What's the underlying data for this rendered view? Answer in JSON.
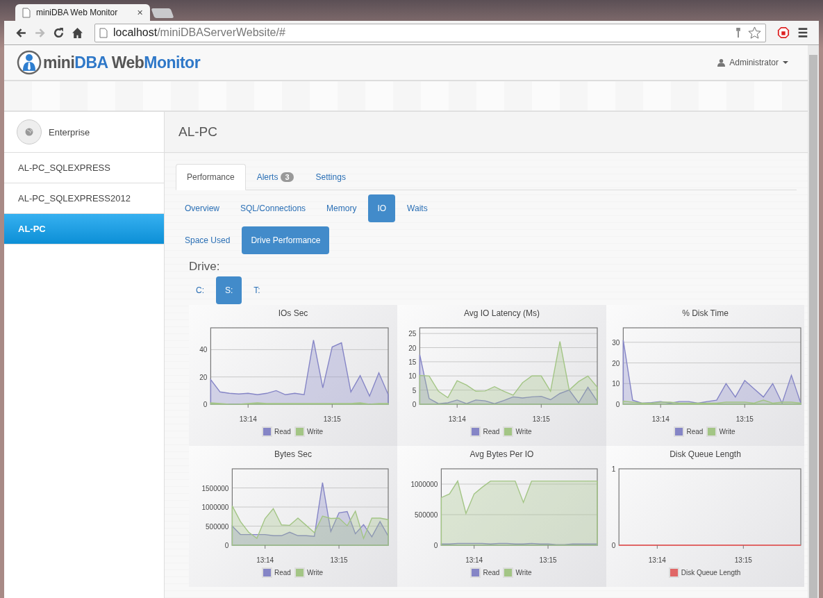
{
  "browser": {
    "tab_title": "miniDBA Web Monitor",
    "tab_close": "✕",
    "address": [
      {
        "text": "localhost",
        "dim": false
      },
      {
        "text": "/miniDBAServerWebsite/#",
        "dim": true
      }
    ]
  },
  "app": {
    "logo": [
      {
        "text": "mini",
        "accent": false
      },
      {
        "text": "DBA",
        "accent": true
      },
      {
        "text": " Web",
        "accent": false
      },
      {
        "text": "Monitor",
        "accent": true
      }
    ],
    "user": "Administrator"
  },
  "sidebar": {
    "items": [
      {
        "label": "Enterprise",
        "kind": "group",
        "selected": false
      },
      {
        "label": "AL-PC_SQLEXPRESS",
        "kind": "server",
        "selected": false
      },
      {
        "label": "AL-PC_SQLEXPRESS2012",
        "kind": "server",
        "selected": false
      },
      {
        "label": "AL-PC",
        "kind": "server",
        "selected": true
      }
    ]
  },
  "page_title": "AL-PC",
  "tabs": [
    {
      "label": "Performance",
      "selected": true
    },
    {
      "label": "Alerts",
      "badge": "3",
      "selected": false
    },
    {
      "label": "Settings",
      "selected": false
    }
  ],
  "subtabs": [
    {
      "label": "Overview",
      "selected": false
    },
    {
      "label": "SQL/Connections",
      "selected": false
    },
    {
      "label": "Memory",
      "selected": false
    },
    {
      "label": "IO",
      "selected": true
    },
    {
      "label": "Waits",
      "selected": false
    }
  ],
  "subtabs_2": [
    {
      "label": "Space Used",
      "selected": false
    },
    {
      "label": "Drive Performance",
      "selected": true
    }
  ],
  "drive": {
    "label": "Drive:",
    "options": [
      {
        "label": "C:",
        "selected": false
      },
      {
        "label": "S:",
        "selected": true
      },
      {
        "label": "T:",
        "selected": false
      }
    ]
  },
  "charts": [
    {
      "chart_data": {
        "type": "area",
        "grid": true,
        "legend": "bottom",
        "title": "IOs Sec",
        "categories": [
          null,
          null,
          null,
          null,
          "13:14",
          null,
          null,
          null,
          null,
          null,
          null,
          null,
          null,
          "13:15",
          null,
          null,
          null,
          null,
          null,
          null
        ],
        "ylim": [
          0,
          56
        ],
        "yticks": [
          0,
          20,
          40
        ],
        "series": [
          {
            "name": "Read",
            "color": "#8585c6",
            "values": [
              18,
              9,
              8,
              7.5,
              8,
              7,
              8,
              10,
              7,
              8,
              7,
              47,
              12,
              42,
              45,
              9,
              21,
              6,
              23,
              7
            ]
          },
          {
            "name": "Write",
            "color": "#a3c585",
            "values": [
              1,
              0.5,
              0,
              0,
              0.5,
              1,
              0.5,
              0.5,
              0.5,
              0.5,
              0.5,
              0.5,
              0.5,
              0.5,
              0.5,
              0.5,
              1,
              0,
              0.5,
              0.5
            ]
          }
        ]
      }
    },
    {
      "chart_data": {
        "type": "area",
        "grid": true,
        "legend": "bottom",
        "title": "Avg IO Latency (Ms)",
        "categories": [
          null,
          null,
          null,
          null,
          "13:14",
          null,
          null,
          null,
          null,
          null,
          null,
          null,
          null,
          "13:15",
          null,
          null,
          null,
          null,
          null,
          null
        ],
        "ylim": [
          0,
          27
        ],
        "yticks": [
          0,
          5,
          10,
          15,
          20,
          25
        ],
        "series": [
          {
            "name": "Read",
            "color": "#8585c6",
            "values": [
              17.5,
              2,
              0.2,
              0.5,
              1.5,
              0.2,
              1.5,
              1.2,
              0.2,
              1.3,
              2.6,
              2.2,
              2.6,
              2.8,
              1.6,
              3.8,
              5,
              0.5,
              6,
              1
            ]
          },
          {
            "name": "Write",
            "color": "#a3c585",
            "values": [
              10.2,
              10,
              4.6,
              2.3,
              8.3,
              6.8,
              4.6,
              4.7,
              6.2,
              4.6,
              3.2,
              7.6,
              10,
              10,
              4.6,
              22.2,
              5,
              8,
              10,
              6
            ]
          }
        ]
      }
    },
    {
      "chart_data": {
        "type": "area",
        "grid": true,
        "legend": "bottom",
        "title": "% Disk Time",
        "categories": [
          null,
          null,
          null,
          null,
          "13:14",
          null,
          null,
          null,
          null,
          null,
          null,
          null,
          null,
          "13:15",
          null,
          null,
          null,
          null,
          null,
          null
        ],
        "ylim": [
          0,
          37
        ],
        "yticks": [
          0,
          10,
          20,
          30
        ],
        "series": [
          {
            "name": "Read",
            "color": "#8585c6",
            "values": [
              31,
              2,
              0.5,
              0.8,
              1.3,
              0.5,
              1.3,
              1.3,
              0.5,
              1.3,
              2,
              10,
              3.5,
              11.5,
              7.5,
              3.5,
              10,
              0.5,
              14,
              0.5
            ]
          },
          {
            "name": "Write",
            "color": "#a3c585",
            "values": [
              1.5,
              1,
              0.5,
              0.5,
              1,
              1,
              0.5,
              0.5,
              0.5,
              0.5,
              0.5,
              1,
              1,
              1,
              0.5,
              2,
              0.5,
              1,
              1,
              0.5
            ]
          }
        ]
      }
    },
    {
      "chart_data": {
        "type": "area",
        "grid": true,
        "legend": "bottom",
        "title": "Bytes Sec",
        "categories": [
          null,
          null,
          null,
          null,
          "13:14",
          null,
          null,
          null,
          null,
          null,
          null,
          null,
          null,
          "13:15",
          null,
          null,
          null,
          null,
          null,
          null
        ],
        "ylim": [
          0,
          2000000
        ],
        "yticks": [
          0,
          500000,
          1000000,
          1500000
        ],
        "series": [
          {
            "name": "Read",
            "color": "#8585c6",
            "values": [
              500000,
              280000,
              280000,
              280000,
              280000,
              250000,
              250000,
              340000,
              250000,
              250000,
              230000,
              1640000,
              360000,
              850000,
              880000,
              300000,
              540000,
              220000,
              620000,
              240000
            ]
          },
          {
            "name": "Write",
            "color": "#a3c585",
            "values": [
              1030000,
              620000,
              340000,
              180000,
              700000,
              960000,
              530000,
              520000,
              710000,
              520000,
              330000,
              760000,
              700000,
              710000,
              510000,
              890000,
              180000,
              710000,
              710000,
              670000
            ]
          }
        ]
      }
    },
    {
      "chart_data": {
        "type": "area",
        "grid": true,
        "legend": "bottom",
        "title": "Avg Bytes Per IO",
        "categories": [
          null,
          null,
          null,
          null,
          "13:14",
          null,
          null,
          null,
          null,
          null,
          null,
          null,
          null,
          "13:15",
          null,
          null,
          null,
          null,
          null,
          null
        ],
        "ylim": [
          0,
          1250000
        ],
        "yticks": [
          0,
          500000,
          1000000
        ],
        "series": [
          {
            "name": "Read",
            "color": "#8585c6",
            "values": [
              20000,
              20000,
              30000,
              30000,
              30000,
              30000,
              20000,
              30000,
              30000,
              20000,
              20000,
              30000,
              20000,
              20000,
              10000,
              10000,
              20000,
              20000,
              20000,
              20000
            ]
          },
          {
            "name": "Write",
            "color": "#a3c585",
            "values": [
              780000,
              840000,
              1050000,
              520000,
              840000,
              950000,
              1050000,
              1050000,
              1050000,
              1050000,
              700000,
              1050000,
              1050000,
              1050000,
              1050000,
              1050000,
              1050000,
              1050000,
              1050000,
              1050000
            ]
          }
        ]
      }
    },
    {
      "chart_data": {
        "type": "line",
        "grid": false,
        "legend": "bottom",
        "title": "Disk Queue Length",
        "categories": [
          null,
          null,
          null,
          null,
          "13:14",
          null,
          null,
          null,
          null,
          null,
          null,
          null,
          null,
          "13:15",
          null,
          null,
          null,
          null,
          null,
          null
        ],
        "ylim": [
          0,
          1
        ],
        "yticks": [
          0,
          1
        ],
        "series": [
          {
            "name": "Disk Queue Length",
            "color": "#e06666",
            "values": [
              0,
              0,
              0,
              0,
              0,
              0,
              0,
              0,
              0,
              0,
              0,
              0,
              0,
              0,
              0,
              0,
              0,
              0,
              0,
              0
            ]
          }
        ]
      }
    }
  ]
}
